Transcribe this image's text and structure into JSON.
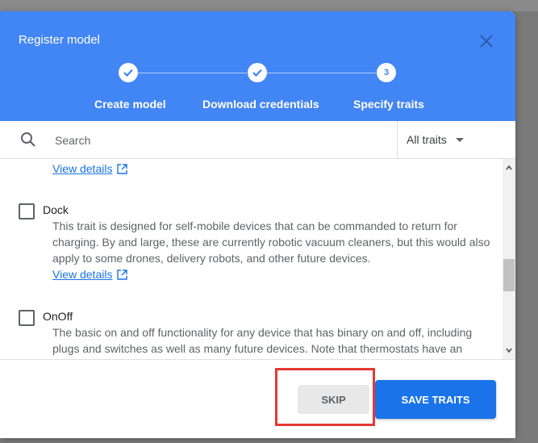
{
  "dialog": {
    "title": "Register model",
    "steps": [
      {
        "label": "Create model",
        "state": "done",
        "icon": "check-icon"
      },
      {
        "label": "Download credentials",
        "state": "done",
        "icon": "check-icon"
      },
      {
        "label": "Specify traits",
        "state": "current",
        "number": "3"
      }
    ]
  },
  "search": {
    "placeholder": "Search",
    "filter_label": "All traits"
  },
  "list": {
    "top_link": "View details",
    "traits": [
      {
        "name": "Dock",
        "checked": false,
        "description": [
          "This trait is designed for self-mobile devices that can be commanded to return for",
          "charging. By and large, these are currently robotic vacuum cleaners, but this would also",
          "apply to some drones, delivery robots, and other future devices."
        ],
        "link": "View details"
      },
      {
        "name": "OnOff",
        "checked": false,
        "description": [
          "The basic on and off functionality for any device that has binary on and off, including",
          "plugs and switches as well as many future devices. Note that thermostats have an"
        ]
      }
    ]
  },
  "footer": {
    "skip_label": "SKIP",
    "save_label": "SAVE TRAITS"
  },
  "colors": {
    "header": "#4285f4",
    "primary_button": "#1a73e8",
    "link": "#1a73e8",
    "highlight": "#e53935"
  }
}
